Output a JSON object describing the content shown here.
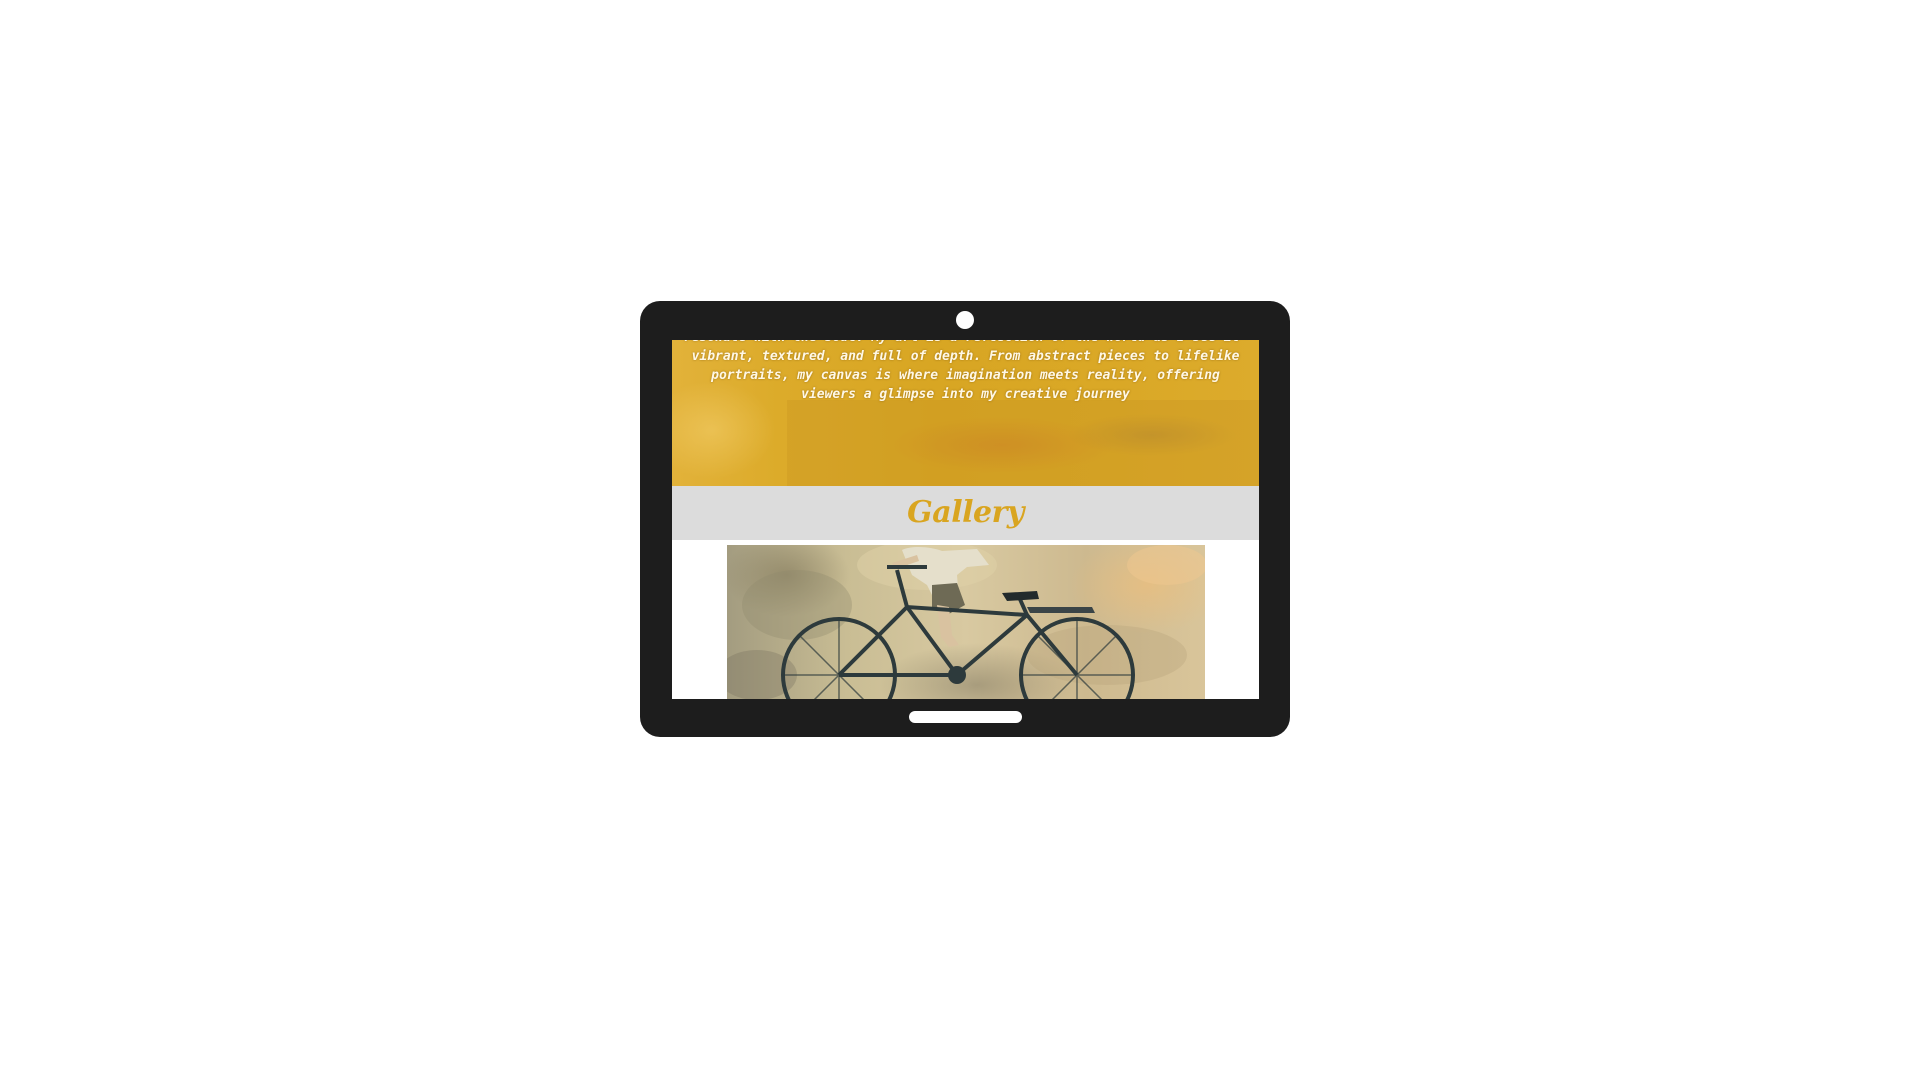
{
  "hero": {
    "text": "resonate with the soul. My art is a reflection of the world as I see it— vibrant, textured, and full of depth. From abstract pieces to lifelike portraits, my canvas is where imagination meets reality, offering viewers a glimpse into my creative journey"
  },
  "gallery": {
    "title": "Gallery",
    "image_alt": "Mural of a child riding a real bicycle mounted against a weathered wall"
  },
  "colors": {
    "hero_bg": "#dcab2a",
    "gallery_title": "#d9a520",
    "gallery_bar": "#dcdcdc",
    "device_frame": "#1d1d1d"
  }
}
